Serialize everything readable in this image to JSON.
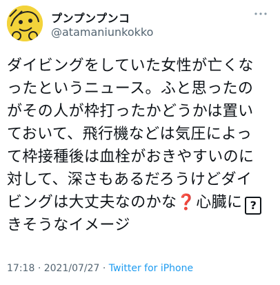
{
  "author": {
    "display_name": "プンプンプンコ",
    "handle": "@atamaniunkokko",
    "avatar_icon": "cartoon-avatar-icon"
  },
  "more_icon": "ellipsis-icon",
  "tweet": {
    "lines": [
      "ダイビングをしていた女性が亡くな",
      "ったというニュース。ふと思ったの",
      "がその人が枠打ったかどうかは置い",
      "ておいて、飛行機などは気圧によっ",
      "て枠接種後は血栓がおきやすいのに",
      "対して、深さもあるだろうけどダイ"
    ],
    "line7_text": "ビングは大丈夫なのかな",
    "line7_emoji": "❓",
    "line7_tail": "心臓に",
    "line7_unknown_glyph": "?",
    "line8": "きそうなイメージ"
  },
  "meta": {
    "time": "17:18",
    "separator": "·",
    "date": "2021/07/27",
    "source": "Twitter for iPhone"
  },
  "colors": {
    "text": "#0f1419",
    "secondary": "#536471",
    "link": "#1d9bf0",
    "avatar_bg": "#f3d33a"
  }
}
